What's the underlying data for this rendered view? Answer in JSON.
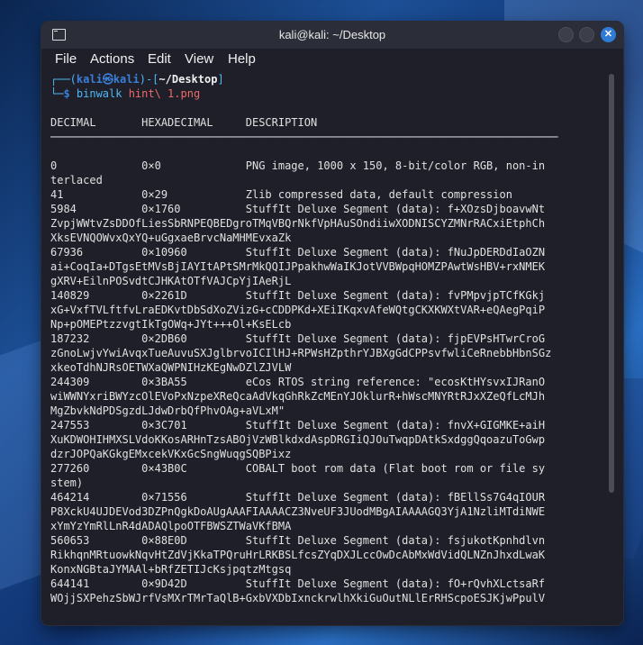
{
  "window": {
    "title": "kali@kali: ~/Desktop",
    "close_glyph": "✕"
  },
  "menu": [
    "File",
    "Actions",
    "Edit",
    "View",
    "Help"
  ],
  "prompt": {
    "open": "┌──(",
    "user": "kali",
    "at": "㉿",
    "host": "kali",
    "mid": ")-[",
    "path": "~/Desktop",
    "close": "]",
    "line2": "└─",
    "dollar": "$ ",
    "command": "binwalk",
    "arg": " hint\\ 1.png"
  },
  "output": {
    "header": "DECIMAL       HEXADECIMAL     DESCRIPTION",
    "separator": "──────────────────────────────────────────────────────────────────────────────",
    "lines": [
      "0             0×0             PNG image, 1000 x 150, 8-bit/color RGB, non-in",
      "terlaced",
      "41            0×29            Zlib compressed data, default compression",
      "5984          0×1760          StuffIt Deluxe Segment (data): f+XOzsDjboavwNt",
      "ZvpjWWtvZsDDOfLiesSbRNPEQBEDgroTMqVBQrNkfVpHAuSOndiiwXODNISCYZMNrRACxiEtphCh",
      "XksEVNQOWvxQxYQ+uGgxaeBrvcNaMHMEvxaZk",
      "67936         0×10960         StuffIt Deluxe Segment (data): fNuJpDERDdIaOZN",
      "ai+CoqIa+DTgsEtMVsBjIAYItAPtSMrMkQQIJPpakhwWaIKJotVVBWpqHOMZPAwtWsHBV+rxNMEK",
      "gXRV+EilnPOSvdtCJHKAtOTfVAJCpYjIAeRjL",
      "140829        0×2261D         StuffIt Deluxe Segment (data): fvPMpvjpTCfKGkj",
      "xG+VxfTVLftfvLraEDKvtDbSdXoZVizG+cCDDPKd+XEiIKqxvAfeWQtgCKXKWXtVAR+eQAegPqiP",
      "Np+pOMEPtzzvgtIkTgOWq+JYt+++Ol+KsELcb",
      "187232        0×2DB60         StuffIt Deluxe Segment (data): fjpEVPsHTwrCroG",
      "zGnoLwjvYwiAvqxTueAuvuSXJglbrvoICIlHJ+RPWsHZpthrYJBXgGdCPPsvfwliCeRnebbHbnSGz",
      "xkeoTdhNJRsOETWXaQWPNIHzKEgNwDZlZJVLW",
      "244309        0×3BA55         eCos RTOS string reference: \"ecosKtHYsvxIJRanO",
      "wiWWNYxriBWYzcOlEVoPxNzpeXReQcaAdVkqGhRkZcMEnYJOklurR+hWscMNYRtRJxXZeQfLcMJh",
      "MgZbvkNdPDSgzdLJdwDrbQfPhvOAg+aVLxM\"",
      "247553        0×3C701         StuffIt Deluxe Segment (data): fnvX+GIGMKE+aiH",
      "XuKDWOHIHMXSLVdoKKosARHnTzsABOjVzWBlkdxdAspDRGIiQJOuTwqpDAtkSxdggQqoazuToGwp",
      "dzrJOPQaKGkgEMxcekVKxGcSngWuqgSQBPixz",
      "277260        0×43B0C         COBALT boot rom data (Flat boot rom or file sy",
      "stem)",
      "464214        0×71556         StuffIt Deluxe Segment (data): fBEllSs7G4qIOUR",
      "P8XckU4UJDEVod3DZPnQgkDoAUgAAAFIAAAACZ3NveUF3JUodMBgAIAAAAGQ3YjA1NzliMTdiNWE",
      "xYmYzYmRlLnR4dADAQlpoOTFBWSZTWaVKfBMA",
      "560653        0×88E0D         StuffIt Deluxe Segment (data): fsjukotKpnhdlvn",
      "RikhqnMRtuowkNqvHtZdVjKkaTPQruHrLRKBSLfcsZYqDXJLccOwDcAbMxWdVidQLNZnJhxdLwaK",
      "KonxNGBtaJYMAAl+bRfZETIJcKsjpqtzMtgsq",
      "644141        0×9D42D         StuffIt Deluxe Segment (data): fO+rQvhXLctsaRf",
      "WOjjSXPehzSbWJrfVsMXrTMrTaQlB+GxbVXDbIxnckrwlhXkiGuOutNLlErRHScpoESJKjwPpulV"
    ]
  }
}
